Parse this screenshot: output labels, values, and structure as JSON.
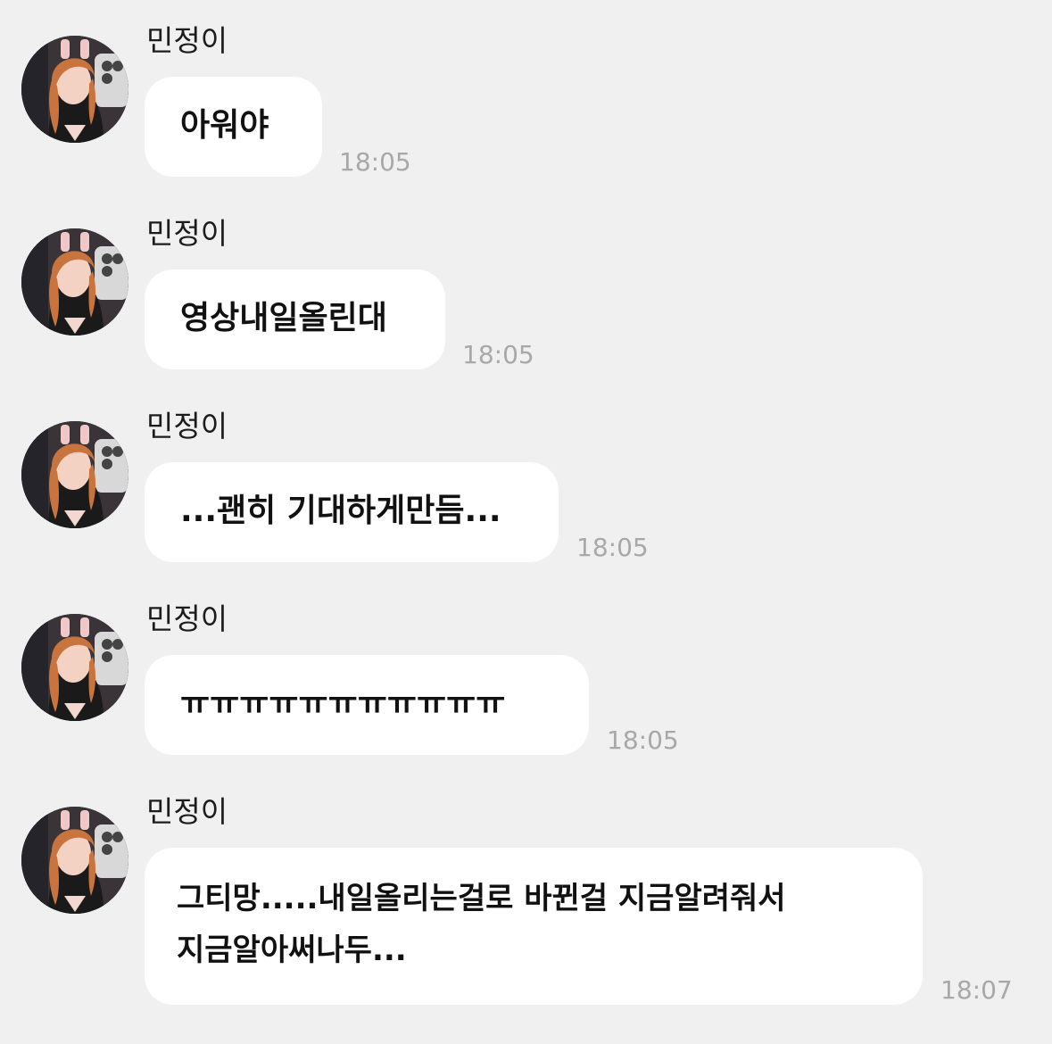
{
  "chat": {
    "messages": [
      {
        "sender": "민정이",
        "text": "아워야",
        "time": "18:05"
      },
      {
        "sender": "민정이",
        "text": "영상내일올린대",
        "time": "18:05"
      },
      {
        "sender": "민정이",
        "text": "...괜히 기대하게만듬...",
        "time": "18:05"
      },
      {
        "sender": "민정이",
        "text": "ㅠㅠㅠㅠㅠㅠㅠㅠㅠㅠㅠ",
        "time": "18:05"
      },
      {
        "sender": "민정이",
        "text_lines": [
          "그티망.....내일올리는걸로 바뀐걸 지금알려줘서",
          "지금알아써나두..."
        ],
        "time": "18:07"
      }
    ]
  },
  "colors": {
    "background": "#f0f0f0",
    "bubble": "#ffffff",
    "timestamp": "#a8a8a8",
    "text": "#111111"
  },
  "icons": {
    "avatar": "profile-photo"
  }
}
